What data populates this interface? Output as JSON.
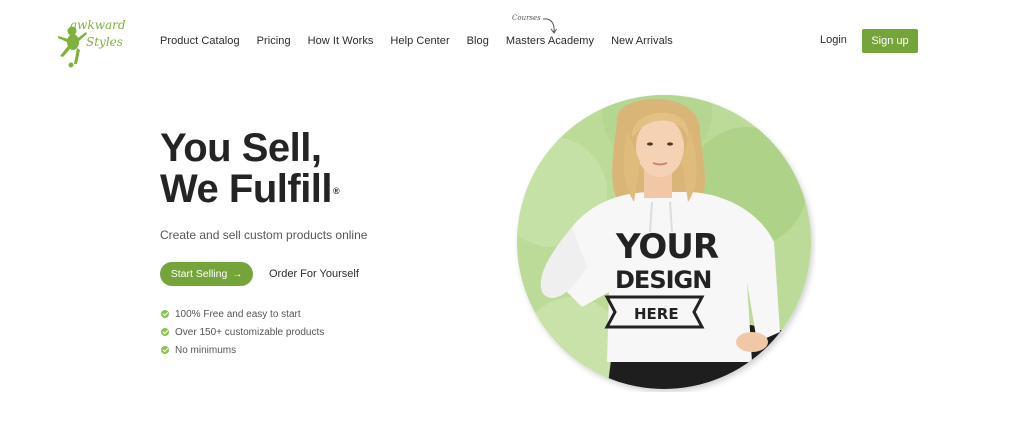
{
  "brand": {
    "name": "awkward styles",
    "logo_icon": "frog-logo-icon",
    "accent_color": "#75a43a",
    "light_accent": "#b8d895"
  },
  "nav": {
    "items": [
      {
        "label": "Product Catalog"
      },
      {
        "label": "Pricing"
      },
      {
        "label": "How It Works"
      },
      {
        "label": "Help Center"
      },
      {
        "label": "Blog"
      },
      {
        "label": "Masters Academy"
      },
      {
        "label": "New Arrivals"
      }
    ],
    "courses_note": "Courses"
  },
  "auth": {
    "login_label": "Login",
    "signup_label": "Sign up"
  },
  "hero": {
    "title_line1": "You Sell,",
    "title_line2": "We Fulfill",
    "registered_mark": "®",
    "subtitle": "Create and sell custom products online",
    "start_selling_label": "Start Selling",
    "start_selling_icon": "arrow-right-icon",
    "order_label": "Order For Yourself",
    "features": [
      {
        "label": "100% Free and easy to start"
      },
      {
        "label": "Over 150+ customizable products"
      },
      {
        "label": "No minimums"
      }
    ],
    "image": {
      "alt": "Model wearing white hoodie with print",
      "shirt_text_line1": "YOUR",
      "shirt_text_line2": "DESIGN",
      "shirt_banner": "HERE"
    }
  }
}
